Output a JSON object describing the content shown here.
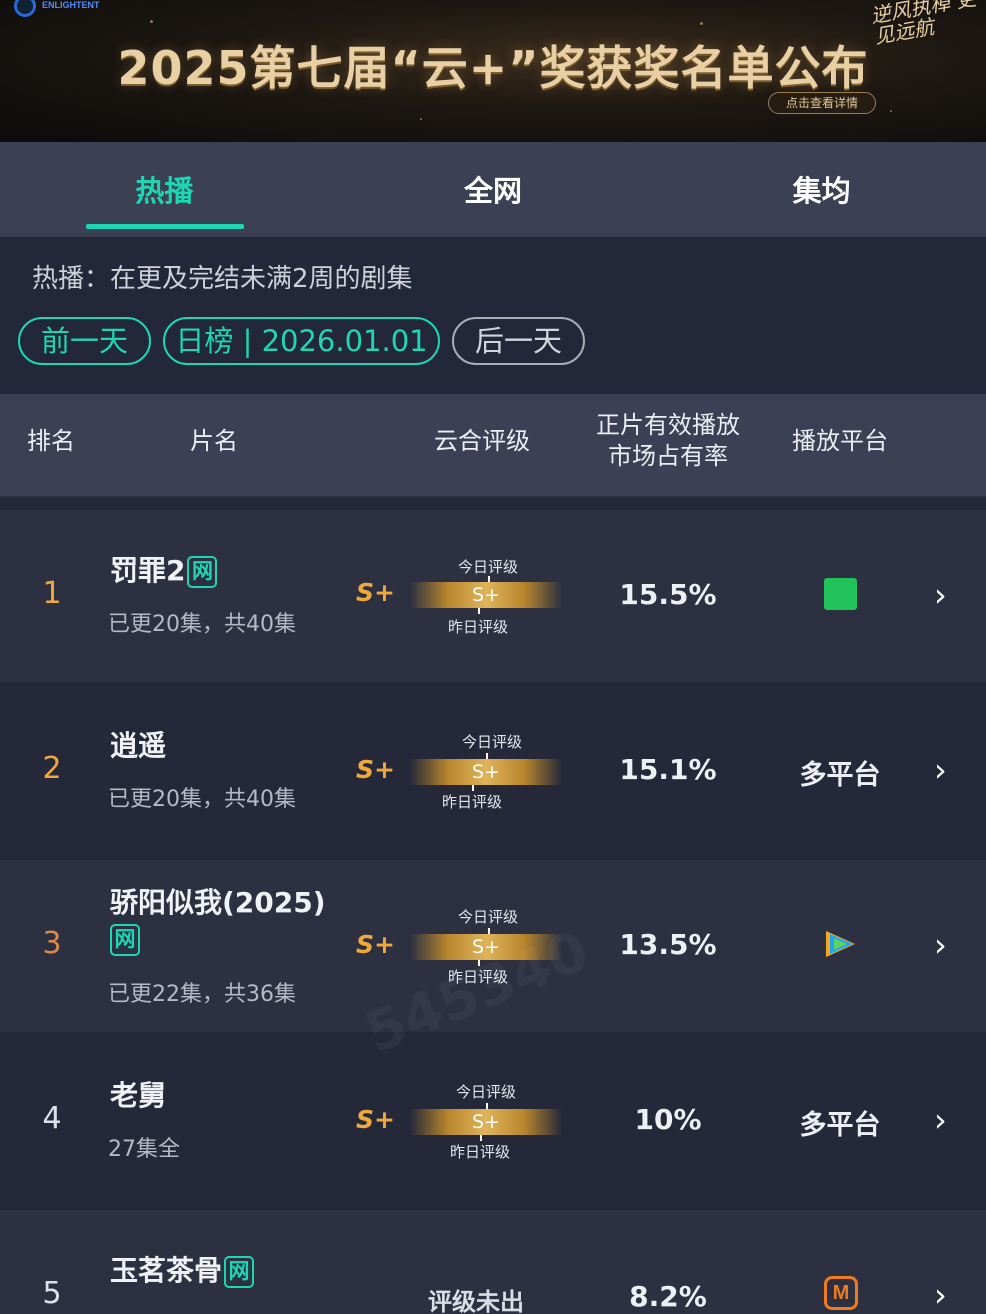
{
  "banner": {
    "logo_text": "ENLIGHTENT",
    "title": "2025第七届“云+”奖获奖名单公布",
    "detail_button": "点击查看详情",
    "slogan": "逆风执棹 更见远航"
  },
  "tabs": [
    {
      "label": "热播",
      "active": true
    },
    {
      "label": "全网",
      "active": false
    },
    {
      "label": "集均",
      "active": false
    }
  ],
  "description": "热播：在更及完结未满2周的剧集",
  "date_nav": {
    "prev": "前一天",
    "current": "日榜 | 2026.01.01",
    "next": "后一天"
  },
  "columns": {
    "rank": "排名",
    "title": "片名",
    "rating": "云合评级",
    "share_line1": "正片有效播放",
    "share_line2": "市场占有率",
    "platform": "播放平台"
  },
  "rating_labels": {
    "today": "今日评级",
    "yesterday": "昨日评级",
    "not_out": "评级未出"
  },
  "rows": [
    {
      "rank": "1",
      "title": "罚罪2",
      "net_badge": "网",
      "episodes": "已更20集，共40集",
      "grade": "S+",
      "bar_grade": "S+",
      "share": "15.5%",
      "platform": "",
      "platform_icon": "iqiyi-icon",
      "rank_color": "#f1a83a"
    },
    {
      "rank": "2",
      "title": "逍遥",
      "net_badge": "",
      "episodes": "已更20集，共40集",
      "grade": "S+",
      "bar_grade": "S+",
      "share": "15.1%",
      "platform": "多平台",
      "platform_icon": "",
      "rank_color": "#f1a83a"
    },
    {
      "rank": "3",
      "title": "骄阳似我(2025)",
      "net_badge": "网",
      "episodes": "已更22集，共36集",
      "grade": "S+",
      "bar_grade": "S+",
      "share": "13.5%",
      "platform": "",
      "platform_icon": "tencent-video-icon",
      "rank_color": "#d98a4a"
    },
    {
      "rank": "4",
      "title": "老舅",
      "net_badge": "",
      "episodes": "27集全",
      "grade": "S+",
      "bar_grade": "S+",
      "share": "10%",
      "platform": "多平台",
      "platform_icon": "",
      "rank_color": "#dfe1e8"
    },
    {
      "rank": "5",
      "title": "玉茗茶骨",
      "net_badge": "网",
      "episodes": "",
      "grade": "",
      "bar_grade": "",
      "share": "8.2%",
      "platform": "",
      "platform_icon": "mango-tv-icon",
      "rank_color": "#dfe1e8"
    }
  ],
  "watermark": "545340"
}
